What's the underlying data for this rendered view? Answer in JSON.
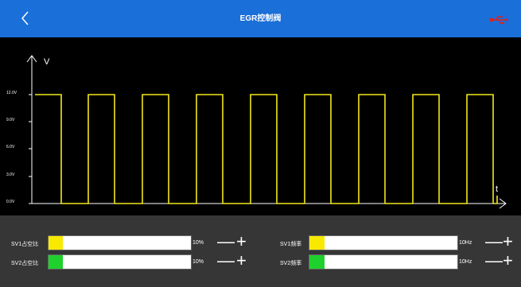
{
  "header": {
    "title": "EGR控制阀",
    "back_icon": "chevron-left-icon",
    "usb_icon": "usb-icon",
    "usb_color": "#e0201a"
  },
  "scope": {
    "y_axis_label": "V",
    "x_axis_label": "t",
    "y_ticks": [
      "12.0V",
      "9.0V",
      "6.0V",
      "3.0V",
      "0.0V"
    ],
    "signal_color": "#f2e81a",
    "signal_high": 12.0,
    "signal_low": 0.0
  },
  "controls": [
    {
      "label": "SV1占空比",
      "value": "10%",
      "fill_fraction": 0.1,
      "fill_color": "#f7ea00",
      "minus": "—",
      "plus": "+"
    },
    {
      "label": "SV2占空比",
      "value": "10%",
      "fill_fraction": 0.1,
      "fill_color": "#1ed12d",
      "minus": "—",
      "plus": "+"
    },
    {
      "label": "SV1频率",
      "value": "10Hz",
      "fill_fraction": 0.1,
      "fill_color": "#f7ea00",
      "minus": "—",
      "plus": "+"
    },
    {
      "label": "SV2频率",
      "value": "10Hz",
      "fill_fraction": 0.1,
      "fill_color": "#1ed12d",
      "minus": "—",
      "plus": "+"
    }
  ]
}
